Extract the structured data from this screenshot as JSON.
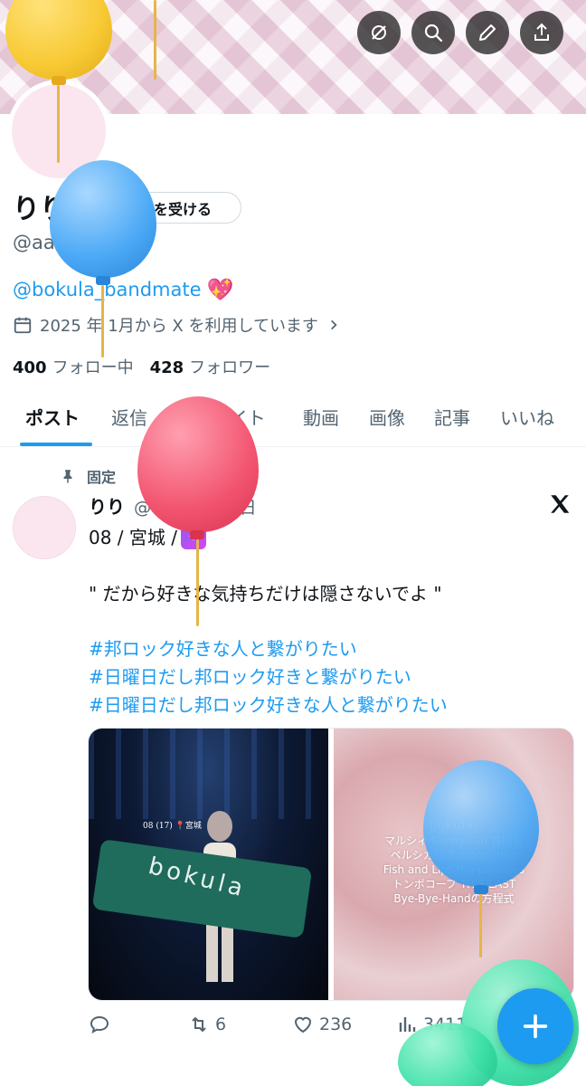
{
  "header": {
    "back_icon": "arrow-left-icon",
    "actions": [
      {
        "icon": "mute-icon"
      },
      {
        "icon": "search-icon"
      },
      {
        "icon": "pencil-icon"
      },
      {
        "icon": "share-icon"
      }
    ]
  },
  "profile": {
    "name": "りり",
    "verify_label": "認証を受ける",
    "handle": "@aak_on",
    "bio_link": "@bokula_bandmate",
    "bio_emoji": "💖",
    "joined": "2025 年 1月から X を利用しています",
    "following_count": "400",
    "following_label": "フォロー中",
    "followers_count": "428",
    "followers_label": "フォロワー"
  },
  "tabs": [
    "ポスト",
    "返信",
    "ハイライト",
    "動画",
    "画像",
    "記事",
    "いいね"
  ],
  "post": {
    "pinned_label": "固定",
    "author_name": "りり",
    "author_meta": "@aak_on · 5日",
    "line1": "08 / 宮城 /",
    "quote": "\" だから好きな気持ちだけは隠さないでよ \"",
    "hashtags": [
      "#邦ロック好きな人と繋がりたい",
      "#日曜日だし邦ロック好きと繋がりたい",
      "#日曜日だし邦ロック好きな人と繋がりたい"
    ],
    "media_left_caption": "08 (17) 📍宮城",
    "media_left_towel": "bokula",
    "media_right_setlist": [
      "bokula.",
      "マルシィ  Sunny Girl  良問答",
      "ペルシカリア  moon drop",
      "Fish and Lips  the parodies",
      "トンボコープ  THIS LAST",
      "Bye-Bye-Handの方程式"
    ],
    "reposts": "6",
    "likes": "236",
    "views": "3411"
  },
  "colors": {
    "accent": "#1d9bf0",
    "balloon_yellow": "#f7c933",
    "balloon_blue": "#4aa8f5",
    "balloon_pink": "#f2546f",
    "balloon_green": "#3de0a8"
  }
}
